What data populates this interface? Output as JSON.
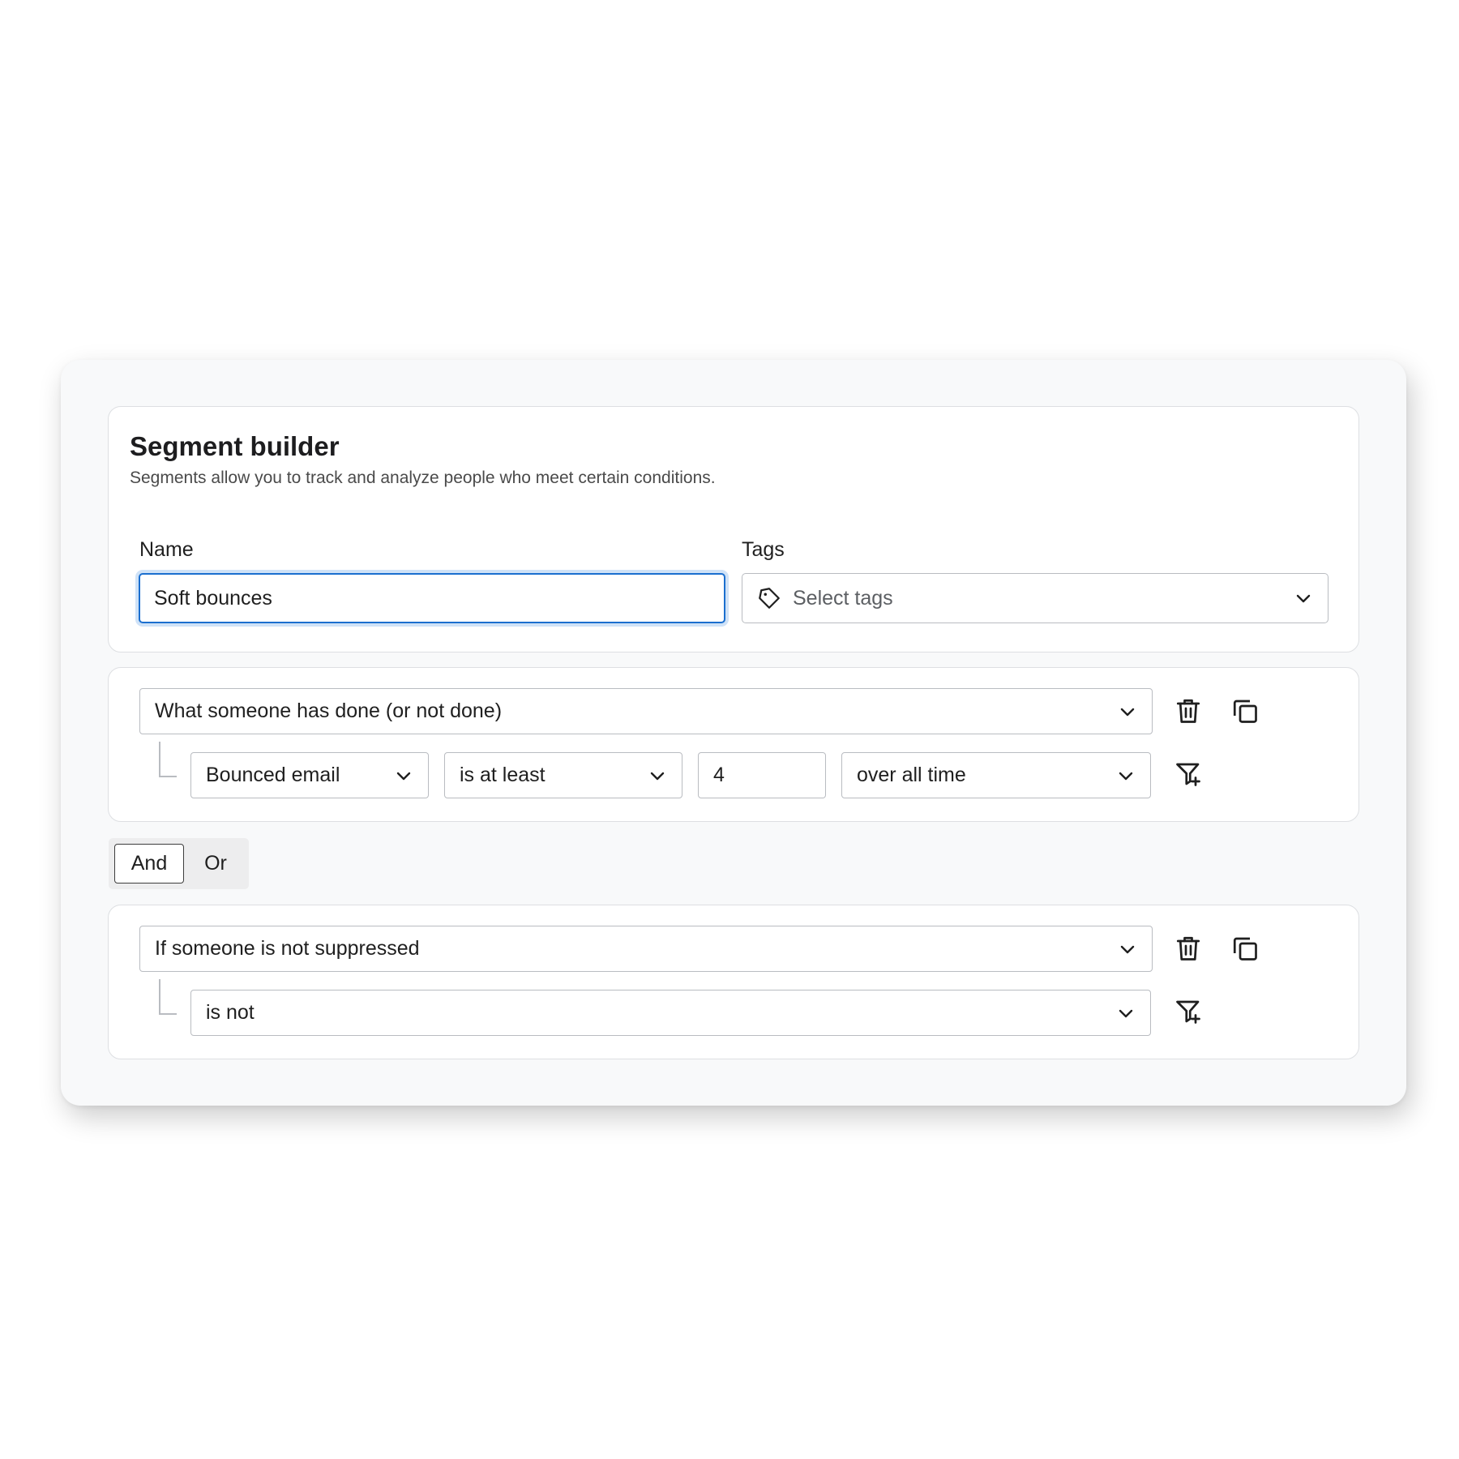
{
  "header": {
    "title": "Segment builder",
    "subtitle": "Segments allow you to track and analyze people who meet certain conditions."
  },
  "name_field": {
    "label": "Name",
    "value": "Soft bounces"
  },
  "tags_field": {
    "label": "Tags",
    "placeholder": "Select tags"
  },
  "condition_1": {
    "type": "What someone has done (or not done)",
    "event": "Bounced email",
    "operator": "is at least",
    "count": "4",
    "timeframe": "over all time"
  },
  "logic": {
    "and_label": "And",
    "or_label": "Or",
    "selected": "And"
  },
  "condition_2": {
    "type": "If someone is not suppressed",
    "operator": "is not"
  },
  "icons": {
    "tag": "tag-icon",
    "chevron": "chevron-down-icon",
    "trash": "trash-icon",
    "copy": "copy-icon",
    "filter_add": "filter-add-icon"
  },
  "colors": {
    "focus_border": "#1b6fcf",
    "focus_ring": "#cfe2f7",
    "panel_bg": "#f8f9fa",
    "card_border": "#dddfe2",
    "input_border": "#b9bcc1"
  }
}
